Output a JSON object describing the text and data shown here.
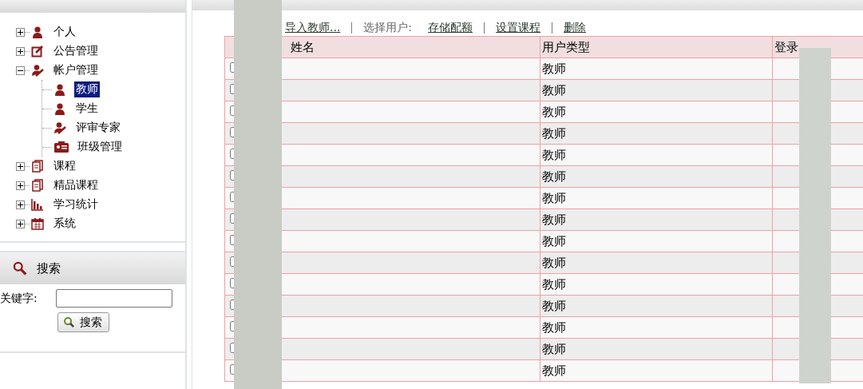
{
  "sidebar": {
    "tree": [
      {
        "label": "个人",
        "kind": "person",
        "expanded": false,
        "selected": false
      },
      {
        "label": "公告管理",
        "kind": "edit",
        "expanded": false,
        "selected": false
      },
      {
        "label": "帐户管理",
        "kind": "expert",
        "expanded": true,
        "selected": false,
        "children": [
          {
            "label": "教师",
            "kind": "person",
            "selected": true
          },
          {
            "label": "学生",
            "kind": "person",
            "selected": false
          },
          {
            "label": "评审专家",
            "kind": "expert",
            "selected": false
          },
          {
            "label": "班级管理",
            "kind": "card",
            "selected": false
          }
        ]
      },
      {
        "label": "课程",
        "kind": "book",
        "expanded": false,
        "selected": false
      },
      {
        "label": "精品课程",
        "kind": "book",
        "expanded": false,
        "selected": false
      },
      {
        "label": "学习统计",
        "kind": "chart",
        "expanded": false,
        "selected": false
      },
      {
        "label": "系统",
        "kind": "calendar",
        "expanded": false,
        "selected": false
      }
    ]
  },
  "search": {
    "title": "搜索",
    "label": "关键字:",
    "button": "搜索"
  },
  "toolbar": {
    "import_link": "导入教师...",
    "select_label": "选择用户:",
    "links": [
      "存储配额",
      "设置课程",
      "删除"
    ]
  },
  "table": {
    "columns": [
      "姓名",
      "用户类型",
      "登录"
    ],
    "rows": [
      {
        "checked": false,
        "type": "教师"
      },
      {
        "checked": false,
        "type": "教师"
      },
      {
        "checked": false,
        "type": "教师"
      },
      {
        "checked": false,
        "type": "教师"
      },
      {
        "checked": false,
        "type": "教师"
      },
      {
        "checked": false,
        "type": "教师"
      },
      {
        "checked": false,
        "type": "教师"
      },
      {
        "checked": false,
        "type": "教师"
      },
      {
        "checked": false,
        "type": "教师"
      },
      {
        "checked": false,
        "type": "教师"
      },
      {
        "checked": false,
        "type": "教师"
      },
      {
        "checked": false,
        "type": "教师"
      },
      {
        "checked": false,
        "type": "教师"
      },
      {
        "checked": false,
        "type": "教师"
      },
      {
        "checked": false,
        "type": "教师"
      }
    ]
  }
}
